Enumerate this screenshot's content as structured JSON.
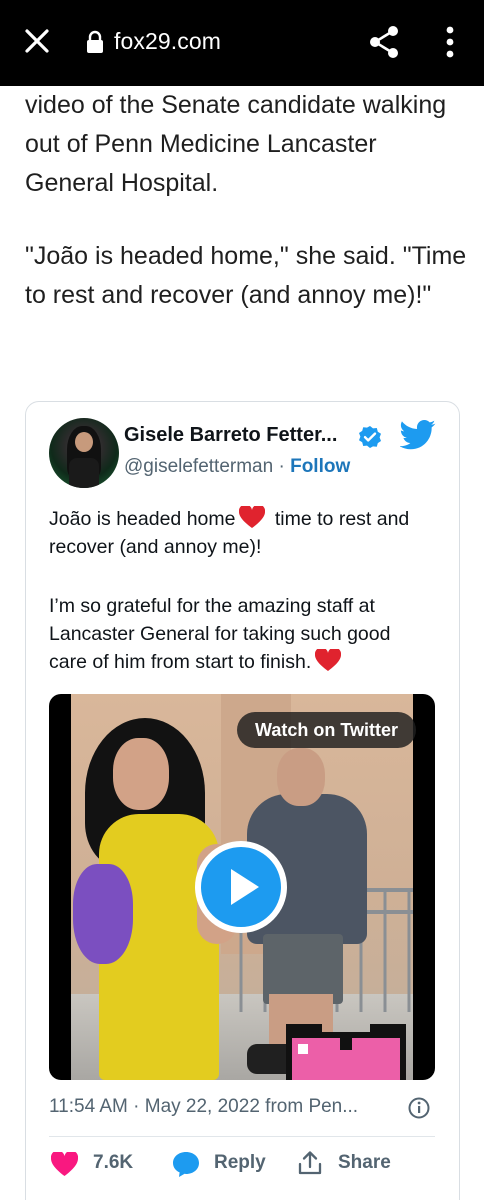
{
  "browser": {
    "url": "fox29.com",
    "icons": {
      "close": "close-icon",
      "lock": "lock-icon",
      "share": "share-icon",
      "more": "more-vert-icon"
    }
  },
  "article": {
    "para1": "video of the Senate candidate walking out of Penn Medicine Lancaster General Hospital.",
    "para2": "\"João is headed home,\" she said. \"Time to rest and recover (and annoy me)!\""
  },
  "tweet": {
    "author_name": "Gisele Barreto Fetter...",
    "handle": "@giselefetterman",
    "separator": " · ",
    "follow_label": "Follow",
    "text1_a": "João is headed home",
    "text1_b": " time to rest and recover (and annoy me)!",
    "text2": "I’m so grateful for the amazing staff at Lancaster General for taking such good care of him from start to finish.",
    "video_button": "Watch on Twitter",
    "timestamp": "11:54 AM · May 22, 2022 from Pen...",
    "like_count": "7.6K",
    "reply_label": "Reply",
    "share_label": "Share",
    "colors": {
      "twitter_blue": "#1d9bf0",
      "like_pink": "#f91880",
      "reply_blue": "#1d9bf0",
      "follow_blue": "#1d76ba"
    }
  }
}
